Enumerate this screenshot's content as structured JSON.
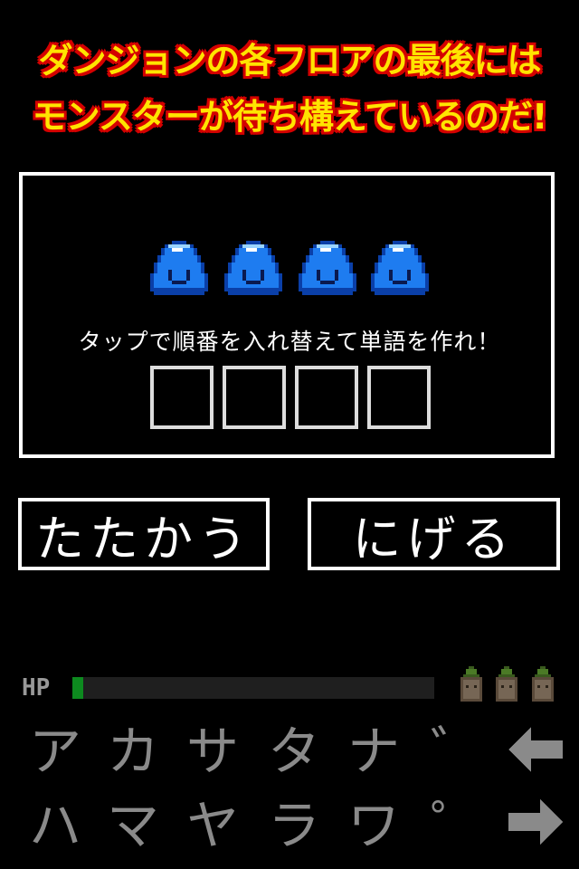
{
  "banner": {
    "line1": "ダンジョンの各フロアの最後には",
    "line2": "モンスターが待ち構えているのだ!"
  },
  "battle": {
    "monster_count": 4,
    "instruction": "タップで順番を入れ替えて単語を作れ！",
    "answer_slots": 4
  },
  "commands": {
    "fight_label": "たたかう",
    "flee_label": "にげる"
  },
  "status": {
    "hp_label": "HP",
    "hp_fraction": 0.03,
    "lives": 3
  },
  "keyboard": {
    "row1": [
      "ア",
      "カ",
      "サ",
      "タ",
      "ナ",
      "゛"
    ],
    "row2": [
      "ハ",
      "マ",
      "ヤ",
      "ラ",
      "ワ",
      "゜"
    ],
    "back_icon": "arrow-left-icon",
    "forward_icon": "arrow-right-icon"
  },
  "colors": {
    "banner_text": "#ffe400",
    "banner_outline": "#d40000",
    "slime": "#1e7cf0",
    "hp_fill": "#0d8a1f"
  }
}
